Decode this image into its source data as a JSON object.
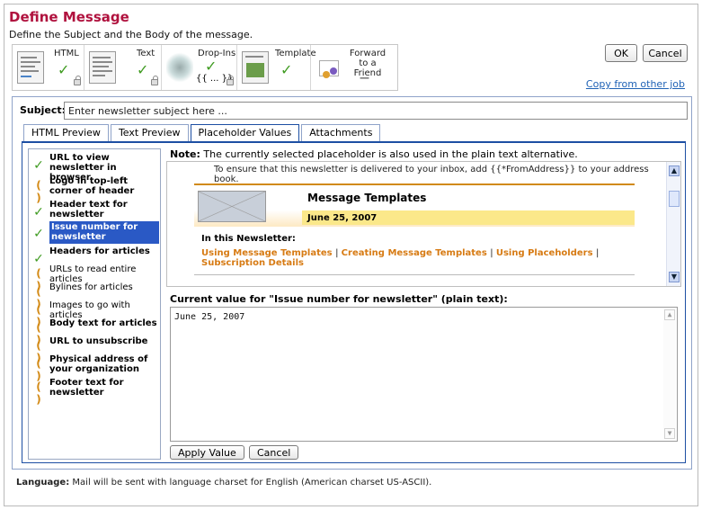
{
  "page": {
    "title": "Define Message",
    "subtitle": "Define the Subject and the Body of the message."
  },
  "toolbar": {
    "items": [
      {
        "label": "HTML",
        "status": "done"
      },
      {
        "label": "Text",
        "status": "done"
      },
      {
        "label": "Drop-Ins",
        "status": "done",
        "glyph": "{{ ... }}"
      },
      {
        "label": "Template",
        "status": "done"
      },
      {
        "label": "Forward to a Friend",
        "status": "none",
        "glyph": "—"
      }
    ],
    "ok_label": "OK",
    "cancel_label": "Cancel",
    "copy_link": "Copy from other job"
  },
  "subject": {
    "label": "Subject:",
    "placeholder": "Enter newsletter subject here ..."
  },
  "tabs": [
    {
      "label": "HTML Preview",
      "active": false
    },
    {
      "label": "Text Preview",
      "active": false
    },
    {
      "label": "Placeholder Values",
      "active": true
    },
    {
      "label": "Attachments",
      "active": false
    }
  ],
  "placeholders": [
    {
      "label": "URL to view newsletter in browser",
      "status": "done",
      "bold": true
    },
    {
      "label": "Logo in top-left corner of header",
      "status": "pending",
      "bold": true
    },
    {
      "label": "Header text for newsletter",
      "status": "done",
      "bold": true
    },
    {
      "label": "Issue number for newsletter",
      "status": "done",
      "bold": true,
      "selected": true
    },
    {
      "label": "Headers for articles",
      "status": "done",
      "bold": true
    },
    {
      "label": "URLs to read entire articles",
      "status": "pending",
      "bold": false
    },
    {
      "label": "Bylines for articles",
      "status": "pending",
      "bold": false
    },
    {
      "label": "Images to go with articles",
      "status": "pending",
      "bold": false
    },
    {
      "label": "Body text for articles",
      "status": "pending",
      "bold": true
    },
    {
      "label": "URL to unsubscribe",
      "status": "pending",
      "bold": true
    },
    {
      "label": "Physical address of your organization",
      "status": "pending",
      "bold": true
    },
    {
      "label": "Footer text for newsletter",
      "status": "pending",
      "bold": true
    }
  ],
  "note": {
    "label": "Note:",
    "text": "The currently selected placeholder is also used in the plain text alternative."
  },
  "preview": {
    "address_line": "To ensure that this newsletter is delivered to your inbox, add {{*FromAddress}} to your address book.",
    "title": "Message Templates",
    "date": "June 25, 2007",
    "in_this": "In this Newsletter:",
    "links": [
      "Using Message Templates",
      "Creating Message Templates",
      "Using Placeholders",
      "Subscription Details"
    ]
  },
  "current_value": {
    "title": "Current value for \"Issue number for newsletter\" (plain text):",
    "value": "June 25, 2007",
    "apply_label": "Apply Value",
    "cancel_label": "Cancel"
  },
  "language": {
    "label": "Language:",
    "text": "Mail will be sent with language charset for English (American charset US-ASCII)."
  },
  "colors": {
    "title": "#b0123e",
    "selected": "#2a59c5",
    "done": "#3f9b21",
    "pending": "#d38a16",
    "link": "#d77b14"
  }
}
